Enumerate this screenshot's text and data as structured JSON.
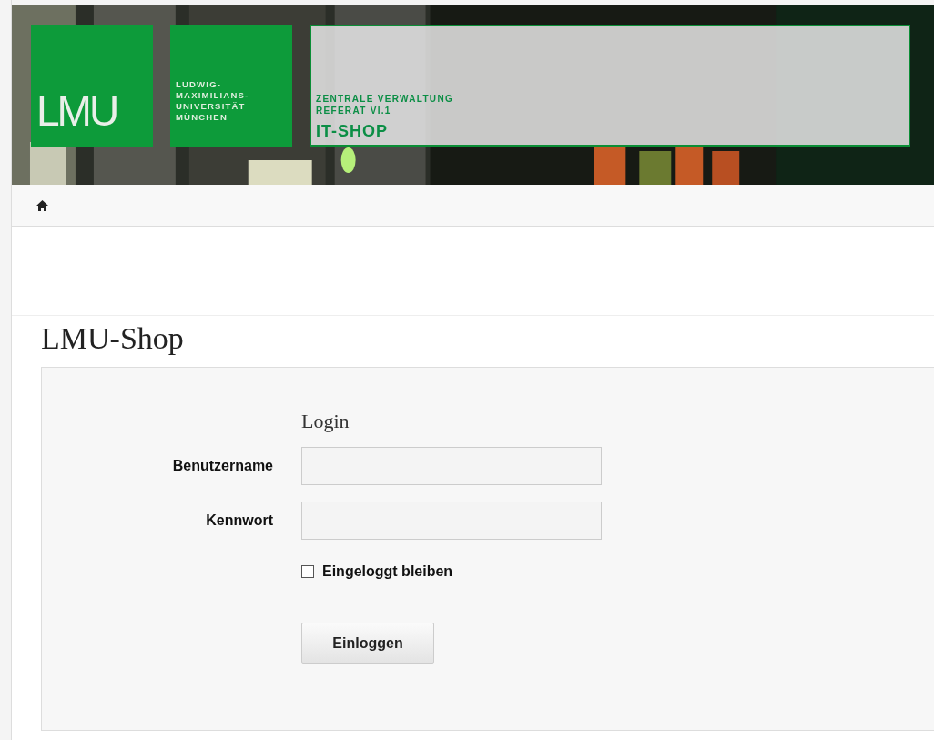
{
  "header": {
    "logo": "LMU",
    "university": [
      "LUDWIG-",
      "MAXIMILIANS-",
      "UNIVERSITÄT",
      "MÜNCHEN"
    ],
    "department": "ZENTRALE VERWALTUNG",
    "unit": "REFERAT VI.1",
    "shop": "IT-SHOP"
  },
  "page_title": "LMU-Shop",
  "login": {
    "title": "Login",
    "fields": [
      {
        "label": "Benutzername"
      },
      {
        "label": "Kennwort"
      }
    ],
    "remember": {
      "label": "Eingeloggt bleiben",
      "checked": false
    },
    "button": "Einloggen"
  }
}
